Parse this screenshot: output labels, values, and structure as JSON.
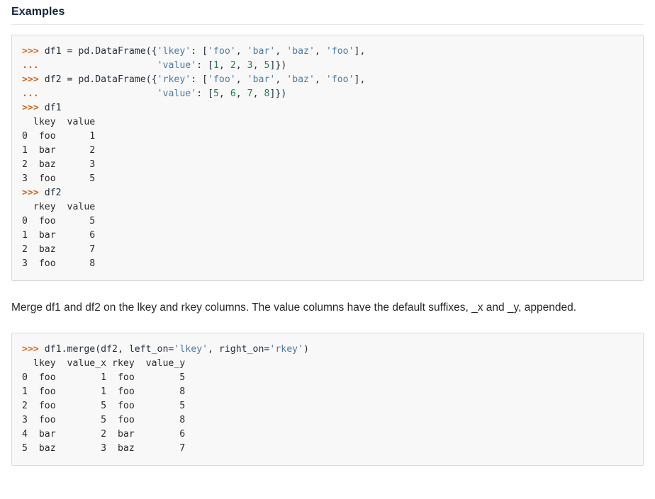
{
  "heading": {
    "title": "Examples"
  },
  "code_block_1": {
    "name": "pandas-merge-setup-example",
    "lines": [
      [
        {
          "t": "prompt",
          "s": ">>> "
        },
        {
          "t": "plain",
          "s": "df1 = pd.DataFrame({"
        },
        {
          "t": "str",
          "s": "'lkey'"
        },
        {
          "t": "plain",
          "s": ": ["
        },
        {
          "t": "str",
          "s": "'foo'"
        },
        {
          "t": "plain",
          "s": ", "
        },
        {
          "t": "str",
          "s": "'bar'"
        },
        {
          "t": "plain",
          "s": ", "
        },
        {
          "t": "str",
          "s": "'baz'"
        },
        {
          "t": "plain",
          "s": ", "
        },
        {
          "t": "str",
          "s": "'foo'"
        },
        {
          "t": "plain",
          "s": "],"
        }
      ],
      [
        {
          "t": "cont",
          "s": "... "
        },
        {
          "t": "plain",
          "s": "                    "
        },
        {
          "t": "str",
          "s": "'value'"
        },
        {
          "t": "plain",
          "s": ": ["
        },
        {
          "t": "num",
          "s": "1"
        },
        {
          "t": "plain",
          "s": ", "
        },
        {
          "t": "num",
          "s": "2"
        },
        {
          "t": "plain",
          "s": ", "
        },
        {
          "t": "num",
          "s": "3"
        },
        {
          "t": "plain",
          "s": ", "
        },
        {
          "t": "num",
          "s": "5"
        },
        {
          "t": "plain",
          "s": "]})"
        }
      ],
      [
        {
          "t": "prompt",
          "s": ">>> "
        },
        {
          "t": "plain",
          "s": "df2 = pd.DataFrame({"
        },
        {
          "t": "str",
          "s": "'rkey'"
        },
        {
          "t": "plain",
          "s": ": ["
        },
        {
          "t": "str",
          "s": "'foo'"
        },
        {
          "t": "plain",
          "s": ", "
        },
        {
          "t": "str",
          "s": "'bar'"
        },
        {
          "t": "plain",
          "s": ", "
        },
        {
          "t": "str",
          "s": "'baz'"
        },
        {
          "t": "plain",
          "s": ", "
        },
        {
          "t": "str",
          "s": "'foo'"
        },
        {
          "t": "plain",
          "s": "],"
        }
      ],
      [
        {
          "t": "cont",
          "s": "... "
        },
        {
          "t": "plain",
          "s": "                    "
        },
        {
          "t": "str",
          "s": "'value'"
        },
        {
          "t": "plain",
          "s": ": ["
        },
        {
          "t": "num",
          "s": "5"
        },
        {
          "t": "plain",
          "s": ", "
        },
        {
          "t": "num",
          "s": "6"
        },
        {
          "t": "plain",
          "s": ", "
        },
        {
          "t": "num",
          "s": "7"
        },
        {
          "t": "plain",
          "s": ", "
        },
        {
          "t": "num",
          "s": "8"
        },
        {
          "t": "plain",
          "s": "]})"
        }
      ],
      [
        {
          "t": "prompt",
          "s": ">>> "
        },
        {
          "t": "plain",
          "s": "df1"
        }
      ],
      [
        {
          "t": "out",
          "s": "  lkey  value"
        }
      ],
      [
        {
          "t": "out",
          "s": "0  foo      1"
        }
      ],
      [
        {
          "t": "out",
          "s": "1  bar      2"
        }
      ],
      [
        {
          "t": "out",
          "s": "2  baz      3"
        }
      ],
      [
        {
          "t": "out",
          "s": "3  foo      5"
        }
      ],
      [
        {
          "t": "prompt",
          "s": ">>> "
        },
        {
          "t": "plain",
          "s": "df2"
        }
      ],
      [
        {
          "t": "out",
          "s": "  rkey  value"
        }
      ],
      [
        {
          "t": "out",
          "s": "0  foo      5"
        }
      ],
      [
        {
          "t": "out",
          "s": "1  bar      6"
        }
      ],
      [
        {
          "t": "out",
          "s": "2  baz      7"
        }
      ],
      [
        {
          "t": "out",
          "s": "3  foo      8"
        }
      ]
    ]
  },
  "paragraph": {
    "text": "Merge df1 and df2 on the lkey and rkey columns. The value columns have the default suffixes, _x and _y, appended."
  },
  "code_block_2": {
    "name": "pandas-merge-result-example",
    "lines": [
      [
        {
          "t": "prompt",
          "s": ">>> "
        },
        {
          "t": "plain",
          "s": "df1.merge(df2, left_on="
        },
        {
          "t": "str",
          "s": "'lkey'"
        },
        {
          "t": "plain",
          "s": ", right_on="
        },
        {
          "t": "str",
          "s": "'rkey'"
        },
        {
          "t": "plain",
          "s": ")"
        }
      ],
      [
        {
          "t": "out",
          "s": "  lkey  value_x rkey  value_y"
        }
      ],
      [
        {
          "t": "out",
          "s": "0  foo        1  foo        5"
        }
      ],
      [
        {
          "t": "out",
          "s": "1  foo        1  foo        8"
        }
      ],
      [
        {
          "t": "out",
          "s": "2  foo        5  foo        5"
        }
      ],
      [
        {
          "t": "out",
          "s": "3  foo        5  foo        8"
        }
      ],
      [
        {
          "t": "out",
          "s": "4  bar        2  bar        6"
        }
      ],
      [
        {
          "t": "out",
          "s": "5  baz        3  baz        7"
        }
      ]
    ]
  },
  "colors": {
    "prompt": "#d2691e",
    "string": "#4a7ba7",
    "number": "#208050",
    "code_text": "#1f2d3d",
    "code_background": "#f8f8f8",
    "code_border": "#d8d8d8",
    "heading": "#14243a",
    "body_text": "#26292b"
  }
}
